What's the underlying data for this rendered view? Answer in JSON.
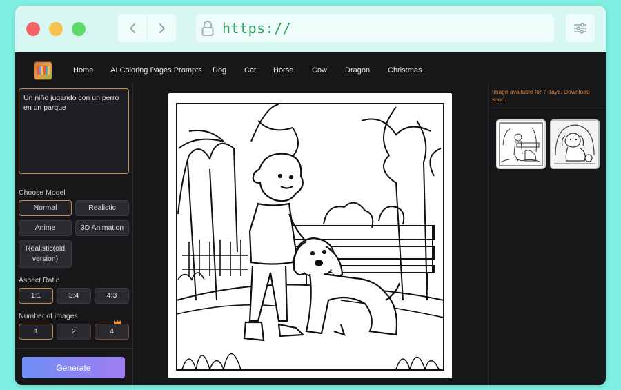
{
  "browser": {
    "url": "https://",
    "icons": [
      "back-chevron-icon",
      "forward-chevron-icon",
      "lock-icon",
      "sliders-icon"
    ]
  },
  "nav": {
    "links": [
      "Home",
      "AI Coloring Pages Prompts",
      "Dog",
      "Cat",
      "Horse",
      "Cow",
      "Dragon",
      "Christmas"
    ]
  },
  "prompt": {
    "text": "Un niño jugando con un perro en un parque"
  },
  "model": {
    "label": "Choose Model",
    "options": [
      "Normal",
      "Realistic",
      "Anime",
      "3D Animation",
      "Realistic(old version)"
    ],
    "selected": "Normal"
  },
  "aspect": {
    "label": "Aspect Ratio",
    "options": [
      "1:1",
      "3:4",
      "4:3"
    ],
    "selected": "1:1"
  },
  "images": {
    "label": "Number of images",
    "options": [
      "1",
      "2",
      "4"
    ],
    "selected": "1",
    "premium_option": "4"
  },
  "generate": {
    "label": "Generate"
  },
  "right": {
    "notice": "Image available for 7 days. Download soon."
  },
  "colors": {
    "accent_border": "#c98a4a",
    "notice": "#d8843a",
    "button_gradient_start": "#6f8ef5",
    "button_gradient_end": "#a07ef0"
  }
}
